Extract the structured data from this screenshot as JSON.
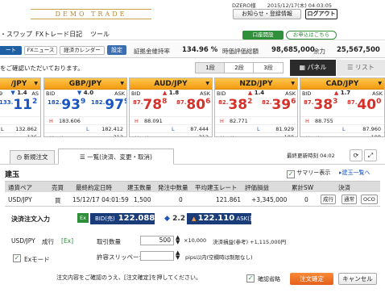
{
  "header": {
    "brand": "DEMO TRADE",
    "user_id": "DZERO様",
    "datetime": "2015/12/17(木) 04:03:05",
    "notice_label": "お知らせ・登録情報",
    "logout_label": "ログアウト"
  },
  "menu": {
    "items": [
      "・スワップ",
      "FXトレード日記",
      "ツール"
    ],
    "account_open": "口座開設",
    "apply_here": "お申込はこちら"
  },
  "toolbar": {
    "rate_label": "ート",
    "news_label": "FXニュース",
    "calendar_label": "経済カレンダー",
    "settings_label": "設定",
    "margin_rate_label": "証拠金維持率",
    "margin_rate_value": "134.96 %",
    "valuation_label": "時価評価総額",
    "valuation_value": "98,685,000",
    "yoryoku_label": "余力",
    "yoryoku_value": "25,567,500"
  },
  "subbar": {
    "message": "をご確認いただいております。",
    "segments": [
      "1段",
      "2段",
      "3段"
    ],
    "panel_label": "パネル",
    "list_label": "リスト"
  },
  "rate_panels": [
    {
      "pair": "/JPY",
      "bid_label": "9",
      "spread": "1.4",
      "ask_label": "AS",
      "bid_small": "133.",
      "bid_big": "11",
      "bid_end": "2",
      "ask_small": "",
      "ask_big": "",
      "ask_end": "",
      "color": "blue",
      "high": "",
      "high_val": "",
      "low": "L",
      "low_val": "132.862",
      "prev": "",
      "prev_val": "126"
    },
    {
      "pair": "GBP/JPY",
      "bid_label": "BID",
      "spread": "4.0",
      "ask_label": "ASK",
      "bid_small": "182.",
      "bid_big": "93",
      "bid_end": "9",
      "ask_small": "182.",
      "ask_big": "97",
      "ask_end": "9",
      "color": "blue",
      "high": "H",
      "high_val": "183.606",
      "low": "L",
      "low_val": "182.412",
      "prev": "前日比",
      "prev_val": "312"
    },
    {
      "pair": "AUD/JPY",
      "bid_label": "BID",
      "spread": "1.8",
      "ask_label": "ASK",
      "bid_small": "87.",
      "bid_big": "78",
      "bid_end": "8",
      "ask_small": "87.",
      "ask_big": "80",
      "ask_end": "6",
      "color": "red",
      "high": "H",
      "high_val": "88.091",
      "low": "L",
      "low_val": "87.444",
      "prev": "前日比",
      "prev_val": "312"
    },
    {
      "pair": "NZD/JPY",
      "bid_label": "BID",
      "spread": "1.4",
      "ask_label": "ASK",
      "bid_small": "82.",
      "bid_big": "38",
      "bid_end": "2",
      "ask_small": "82.",
      "ask_big": "39",
      "ask_end": "6",
      "color": "red",
      "high": "H",
      "high_val": "82.771",
      "low": "L",
      "low_val": "81.929",
      "prev": "前日比",
      "prev_val": "100"
    },
    {
      "pair": "CAD/JPY",
      "bid_label": "BID",
      "spread": "1.7",
      "ask_label": "ASK",
      "bid_small": "87.",
      "bid_big": "38",
      "bid_end": "3",
      "ask_small": "87.",
      "ask_big": "40",
      "ask_end": "0",
      "color": "red",
      "high": "H",
      "high_val": "88.755",
      "low": "L",
      "low_val": "87.960",
      "prev": "前日比",
      "prev_val": "-198"
    }
  ],
  "orders": {
    "new_order_tab": "新規注文",
    "list_tab": "一覧(決済、変更・取消)",
    "update_label": "最終更新時刻",
    "update_time": "04:02",
    "position_title": "建玉",
    "summary_label": "サマリー表示",
    "position_link": "建玉一覧へ",
    "columns": [
      "通貨ペア",
      "売買",
      "最終約定日時",
      "建玉数量",
      "発注中数量",
      "平均建玉レート",
      "評価損益",
      "累計SW",
      "決済"
    ],
    "row": {
      "pair": "USD/JPY",
      "side": "買",
      "datetime": "15/12/17 04:01:59",
      "qty": "1,500",
      "ordering": "0",
      "avg_rate": "121.861",
      "pnl": "+3,345,000",
      "sw": "0",
      "btn1": "成行",
      "btn2": "通常",
      "btn3": "OCO"
    }
  },
  "settle": {
    "title": "決済注文入力",
    "ex": "Ex",
    "bid_label": "BID(売)",
    "bid_value": "122.088",
    "spread": "2.2",
    "ask_value": "122.110",
    "ask_label": "ASK(買)",
    "pair": "USD/JPY",
    "order_type": "成行",
    "order_type_sub": "Ex",
    "qty_label": "取引数量",
    "qty_value": "500",
    "qty_unit": "×10,000",
    "est_label": "決済損益(参考) +1,115,000円",
    "slippage_label": "許容スリッページ",
    "slippage_unit": "pips以内(空欄時は制限なし)",
    "ex_mode_label": "Exモード",
    "footer_msg": "注文内容をご確認のうえ、[注文確定]を押してください。",
    "confirm_skip": "確認省略",
    "confirm_button": "注文確定",
    "cancel_button": "キャンセル"
  }
}
